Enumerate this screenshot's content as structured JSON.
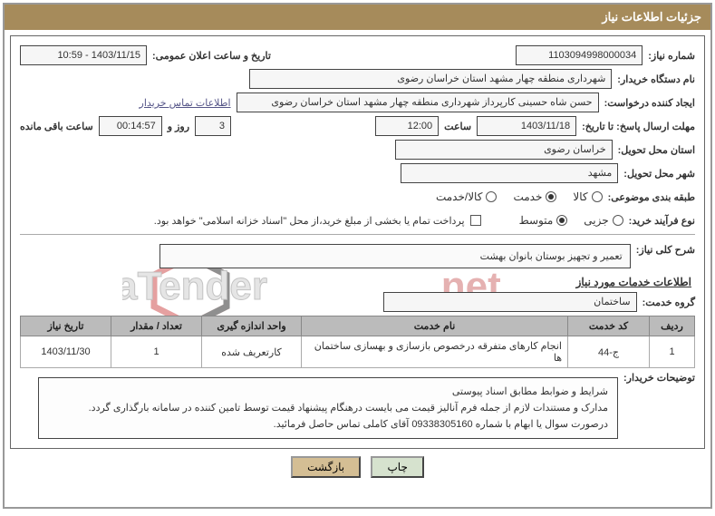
{
  "header": {
    "title": "جزئیات اطلاعات نیاز"
  },
  "fields": {
    "need_number_label": "شماره نیاز:",
    "need_number": "1103094998000034",
    "announce_datetime_label": "تاریخ و ساعت اعلان عمومی:",
    "announce_datetime": "1403/11/15 - 10:59",
    "buyer_org_label": "نام دستگاه خریدار:",
    "buyer_org": "شهرداری منطقه چهار مشهد استان خراسان رضوی",
    "requester_label": "ایجاد کننده درخواست:",
    "requester": "حسن شاه حسینی کارپرداز شهرداری منطقه چهار مشهد استان خراسان رضوی",
    "buyer_contact_link": "اطلاعات تماس خریدار",
    "deadline_label": "مهلت ارسال پاسخ: تا تاریخ:",
    "deadline_date": "1403/11/18",
    "time_label": "ساعت",
    "deadline_time": "12:00",
    "remaining_left": "",
    "remaining_days": "3",
    "day_word": "روز و",
    "remaining_hms": "00:14:57",
    "remaining_tail": "ساعت باقی مانده",
    "delivery_province_label": "استان محل تحویل:",
    "delivery_province": "خراسان رضوی",
    "delivery_city_label": "شهر محل تحویل:",
    "delivery_city": "مشهد",
    "category_label": "طبقه بندی موضوعی:",
    "options": {
      "kala": "کالا",
      "khadamat": "خدمت",
      "kala_khadamat": "کالا/خدمت"
    },
    "purchase_type_label": "نوع فرآیند خرید:",
    "ptype": {
      "jozei": "جزیی",
      "motavaset": "متوسط"
    },
    "payment_note": "پرداخت تمام یا بخشی از مبلغ خرید،از محل \"اسناد خزانه اسلامی\" خواهد بود.",
    "overall_need_label": "شرح کلی نیاز:",
    "overall_need": "تعمیر و تجهیز بوستان بانوان بهشت",
    "services_title": "اطلاعات خدمات مورد نیاز",
    "group_label": "گروه خدمت:",
    "group_value": "ساختمان",
    "buyer_notes_label": "توضیحات خریدار:",
    "buyer_notes_l1": "شرایط و ضوابط مطابق اسناد پیوستی",
    "buyer_notes_l2": "مدارک و مستندات لازم از جمله فرم آنالیز قیمت می بایست درهنگام پیشنهاد قیمت توسط تامین کننده در سامانه بارگذاری گردد.",
    "buyer_notes_l3": "درصورت سوال یا ابهام با شماره 09338305160 آقای کاملی تماس حاصل فرمائید."
  },
  "table": {
    "headers": {
      "row": "ردیف",
      "code": "کد خدمت",
      "name": "نام خدمت",
      "unit": "واحد اندازه گیری",
      "qty": "تعداد / مقدار",
      "date": "تاریخ نیاز"
    },
    "row1": {
      "row": "1",
      "code": "ج-44",
      "name": "انجام کارهای متفرقه درخصوص بازسازی و بهسازی ساختمان ها",
      "unit": "کارتعریف شده",
      "qty": "1",
      "date": "1403/11/30"
    }
  },
  "buttons": {
    "print": "چاپ",
    "back": "بازگشت"
  }
}
